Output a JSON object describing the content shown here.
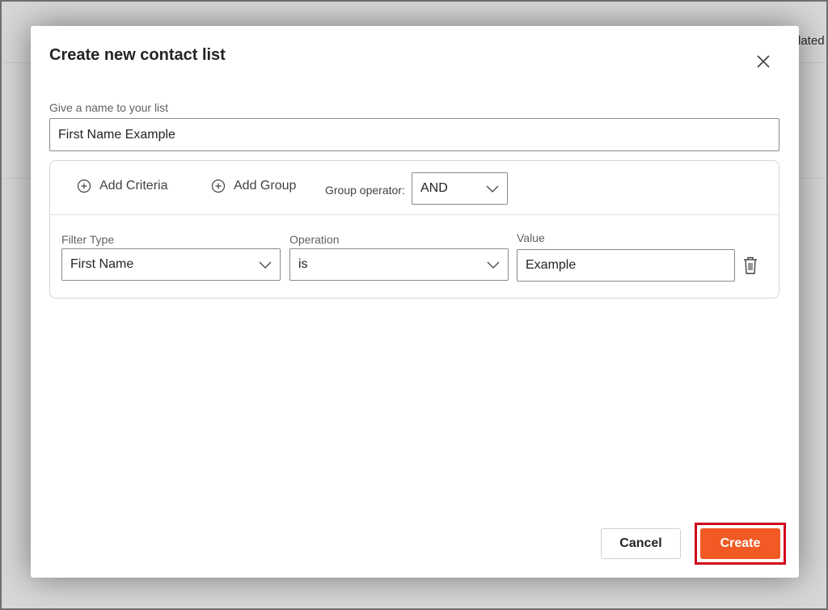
{
  "background": {
    "column_header_fragment": "dated"
  },
  "dialog": {
    "title": "Create new contact list",
    "close_icon": "close-icon",
    "name_field": {
      "label": "Give a name to your list",
      "value": "First Name Example"
    },
    "toolbar": {
      "add_criteria_label": "Add Criteria",
      "add_group_label": "Add Group",
      "group_operator_label": "Group operator:",
      "group_operator_value": "AND"
    },
    "criteria_row": {
      "filter_type_label": "Filter Type",
      "filter_type_value": "First Name",
      "operation_label": "Operation",
      "operation_value": "is",
      "value_label": "Value",
      "value_value": "Example"
    },
    "footer": {
      "cancel_label": "Cancel",
      "create_label": "Create"
    }
  },
  "colors": {
    "accent": "#f15a24",
    "highlight_border": "#d0021b"
  }
}
